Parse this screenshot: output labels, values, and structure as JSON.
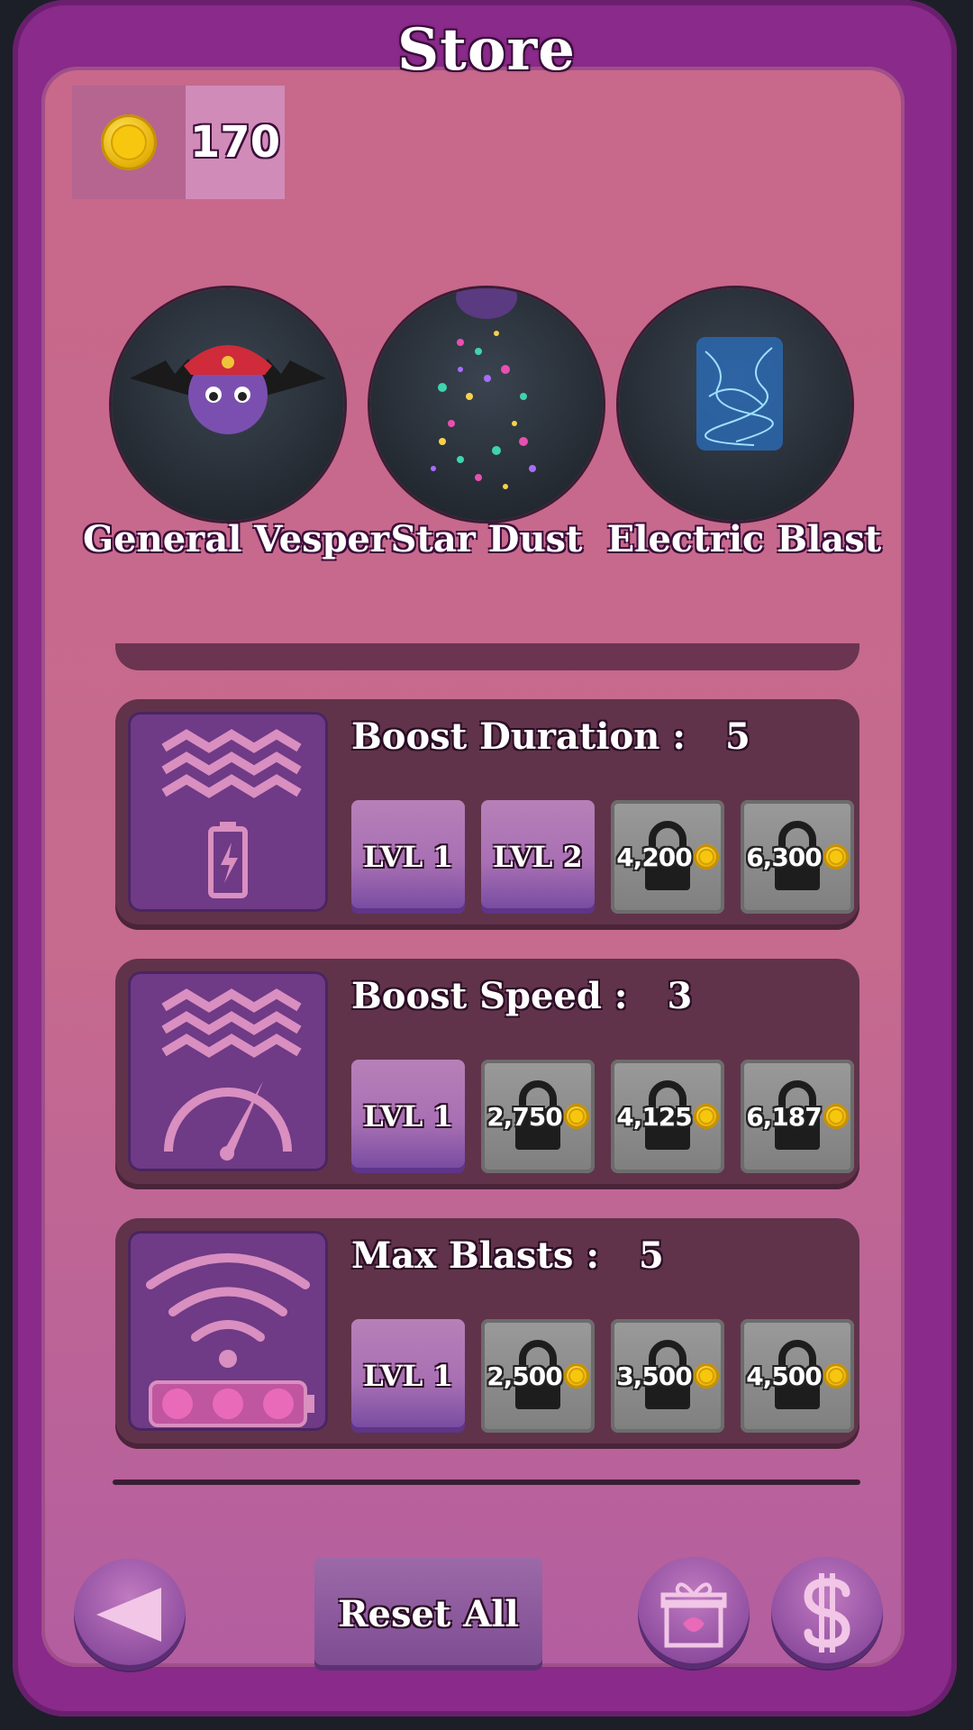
{
  "store": {
    "title": "Store",
    "coins": "170"
  },
  "featured": [
    {
      "label": "General Vesper",
      "icon": "bat-character-icon"
    },
    {
      "label": "Star Dust",
      "icon": "sparkle-particles-icon"
    },
    {
      "label": "Electric Blast",
      "icon": "electric-field-icon"
    }
  ],
  "upgrades": [
    {
      "title": "Boost Duration",
      "separator": ":",
      "value": "5",
      "icon": "boost-duration-icon",
      "levels": [
        {
          "state": "owned",
          "label": "LVL 1"
        },
        {
          "state": "owned",
          "label": "LVL 2"
        },
        {
          "state": "locked",
          "price": "4,200"
        },
        {
          "state": "locked",
          "price": "6,300"
        }
      ]
    },
    {
      "title": "Boost Speed",
      "separator": ":",
      "value": "3",
      "icon": "boost-speed-icon",
      "levels": [
        {
          "state": "owned",
          "label": "LVL 1"
        },
        {
          "state": "locked",
          "price": "2,750"
        },
        {
          "state": "locked",
          "price": "4,125"
        },
        {
          "state": "locked",
          "price": "6,187"
        }
      ]
    },
    {
      "title": "Max Blasts",
      "separator": ":",
      "value": "5",
      "icon": "max-blasts-icon",
      "levels": [
        {
          "state": "owned",
          "label": "LVL 1"
        },
        {
          "state": "locked",
          "price": "2,500"
        },
        {
          "state": "locked",
          "price": "3,500"
        },
        {
          "state": "locked",
          "price": "4,500"
        }
      ]
    }
  ],
  "footer": {
    "reset_label": "Reset All",
    "back_icon": "back-arrow-icon",
    "gift_icon": "gift-icon",
    "purchase_icon": "dollar-icon"
  },
  "colors": {
    "frame": "#8a2a8a",
    "panel": "#c8688a",
    "card": "#60334a",
    "owned_button": "#a870b3",
    "locked_button": "#8a8a8a",
    "coin": "#f7c70f"
  }
}
